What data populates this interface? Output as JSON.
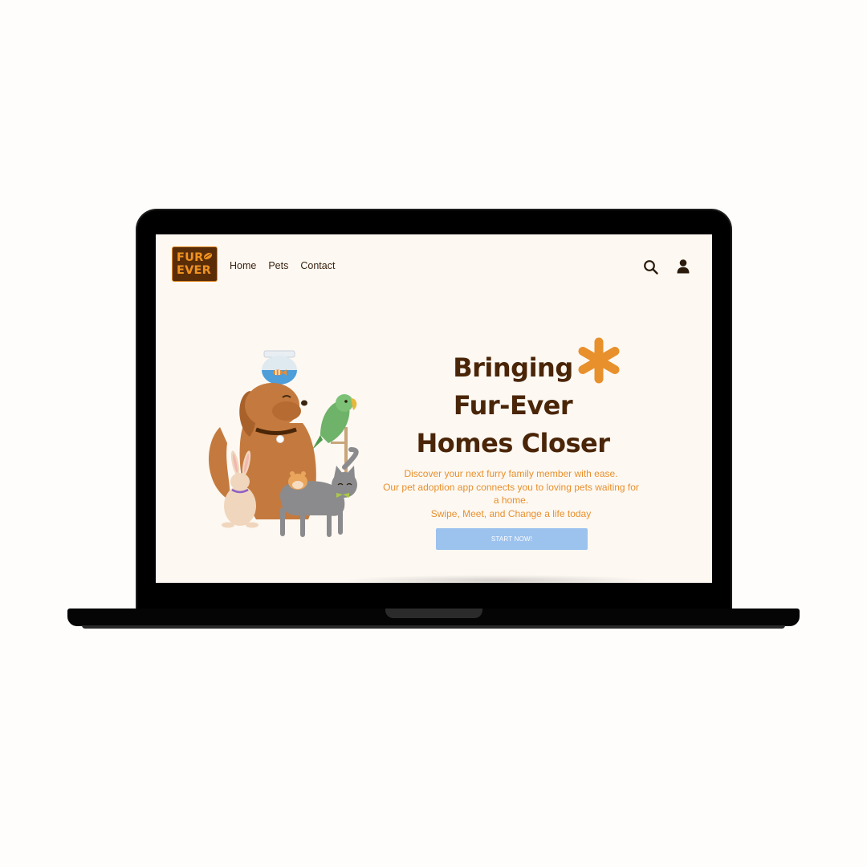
{
  "brand": {
    "logo_line1": "FUR",
    "logo_line2": "EVER",
    "colors": {
      "primary_brown": "#4a2508",
      "accent_orange": "#e8902c",
      "button_blue": "#9cc2ee",
      "background": "#fdf8f2"
    }
  },
  "nav": {
    "items": [
      {
        "label": "Home"
      },
      {
        "label": "Pets"
      },
      {
        "label": "Contact"
      }
    ],
    "icons": [
      "search-icon",
      "user-icon"
    ]
  },
  "hero": {
    "title_lines": [
      "Bringing",
      "Fur-Ever",
      "Homes Closer"
    ],
    "description_lines": [
      "Discover your next furry family member with ease.",
      "Our pet adoption app connects you to loving pets waiting for",
      "a home.",
      "Swipe, Meet, and Change a life today"
    ],
    "cta_label": "START NOW!"
  }
}
